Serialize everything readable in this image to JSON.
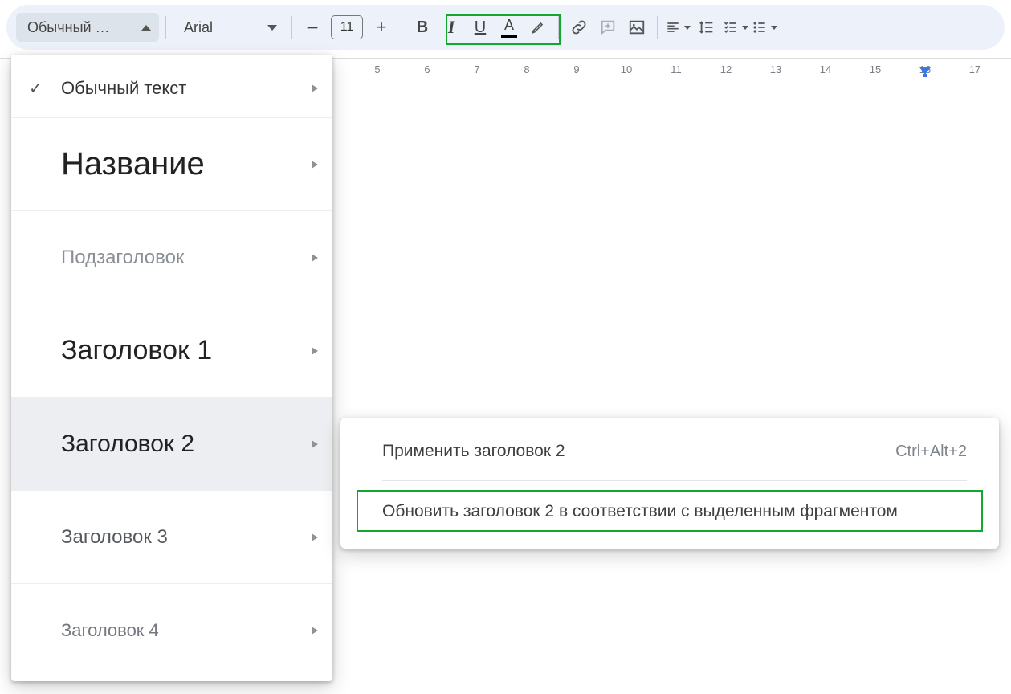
{
  "toolbar": {
    "style_dropdown_label": "Обычный …",
    "font_dropdown_label": "Arial",
    "font_size": "11"
  },
  "ruler": {
    "start": 5,
    "end": 17,
    "marks": [
      5,
      6,
      7,
      8,
      9,
      10,
      11,
      12,
      13,
      14,
      15,
      16,
      17
    ],
    "indent_at": 16
  },
  "style_menu": {
    "items": [
      {
        "label": "Обычный текст",
        "cls": "s-normal",
        "checked": true
      },
      {
        "label": "Название",
        "cls": "s-title"
      },
      {
        "label": "Подзаголовок",
        "cls": "s-subtitle"
      },
      {
        "label": "Заголовок 1",
        "cls": "s-h1"
      },
      {
        "label": "Заголовок 2",
        "cls": "s-h2",
        "selected": true
      },
      {
        "label": "Заголовок 3",
        "cls": "s-h3"
      },
      {
        "label": "Заголовок 4",
        "cls": "s-h4"
      }
    ]
  },
  "submenu": {
    "apply_label": "Применить заголовок 2",
    "apply_shortcut": "Ctrl+Alt+2",
    "update_label": "Обновить заголовок 2 в соответствии с выделенным фрагментом"
  }
}
